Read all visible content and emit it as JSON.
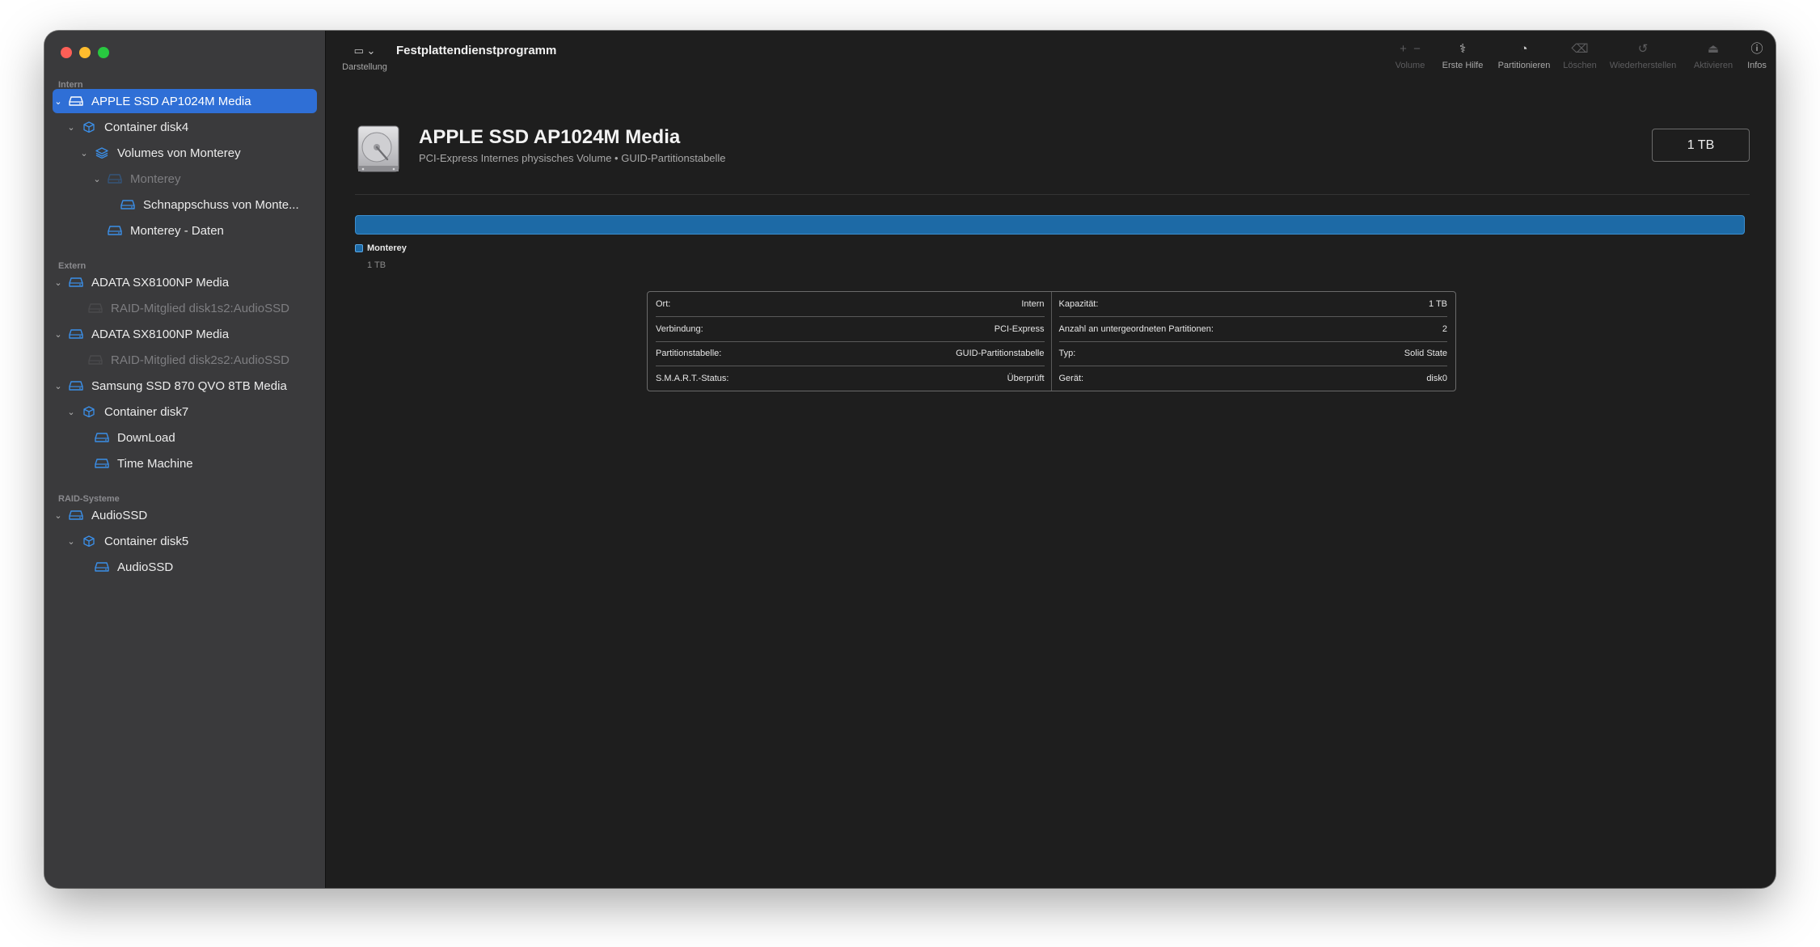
{
  "app": {
    "title": "Festplattendienstprogramm"
  },
  "toolbar": {
    "view_label": "Darstellung",
    "buttons": [
      {
        "label": "Volume",
        "icon": "plus-minus-icon",
        "enabled": false
      },
      {
        "label": "Erste Hilfe",
        "icon": "stethoscope-icon",
        "enabled": true
      },
      {
        "label": "Partitionieren",
        "icon": "pie-chart-icon",
        "enabled": true
      },
      {
        "label": "Löschen",
        "icon": "eraser-icon",
        "enabled": false
      },
      {
        "label": "Wiederherstellen",
        "icon": "restore-icon",
        "enabled": false
      },
      {
        "label": "Aktivieren",
        "icon": "mount-icon",
        "enabled": false
      },
      {
        "label": "Infos",
        "icon": "info-icon",
        "enabled": true
      }
    ]
  },
  "sidebar": {
    "sections": [
      "Intern",
      "Extern",
      "RAID-Systeme"
    ],
    "items": [
      {
        "label": "APPLE SSD AP1024M Media",
        "selected": true
      },
      {
        "label": "Container disk4"
      },
      {
        "label": "Volumes von Monterey"
      },
      {
        "label": "Monterey"
      },
      {
        "label": "Schnappschuss von Monte..."
      },
      {
        "label": "Monterey - Daten"
      },
      {
        "label": "ADATA SX8100NP Media"
      },
      {
        "label": "RAID-Mitglied disk1s2:AudioSSD"
      },
      {
        "label": "ADATA SX8100NP Media"
      },
      {
        "label": "RAID-Mitglied disk2s2:AudioSSD"
      },
      {
        "label": "Samsung SSD 870 QVO 8TB Media"
      },
      {
        "label": "Container disk7"
      },
      {
        "label": "DownLoad"
      },
      {
        "label": "Time Machine"
      },
      {
        "label": "AudioSSD"
      },
      {
        "label": "Container disk5"
      },
      {
        "label": "AudioSSD"
      }
    ]
  },
  "disk": {
    "name": "APPLE SSD AP1024M Media",
    "subtitle": "PCI-Express Internes physisches Volume • GUID-Partitionstabelle",
    "capacity": "1 TB"
  },
  "partition": {
    "name": "Monterey",
    "size": "1 TB",
    "color": "#1d6aa6"
  },
  "info": {
    "left": [
      {
        "label": "Ort:",
        "value": "Intern"
      },
      {
        "label": "Verbindung:",
        "value": "PCI-Express"
      },
      {
        "label": "Partitionstabelle:",
        "value": "GUID-Partitionstabelle"
      },
      {
        "label": "S.M.A.R.T.-Status:",
        "value": "Überprüft"
      }
    ],
    "right": [
      {
        "label": "Kapazität:",
        "value": "1 TB"
      },
      {
        "label": "Anzahl an untergeordneten Partitionen:",
        "value": "2"
      },
      {
        "label": "Typ:",
        "value": "Solid State"
      },
      {
        "label": "Gerät:",
        "value": "disk0"
      }
    ]
  },
  "colors": {
    "accent": "#2f6fd6",
    "icon_blue": "#3b8fe8",
    "bar": "#1d6aa6"
  }
}
